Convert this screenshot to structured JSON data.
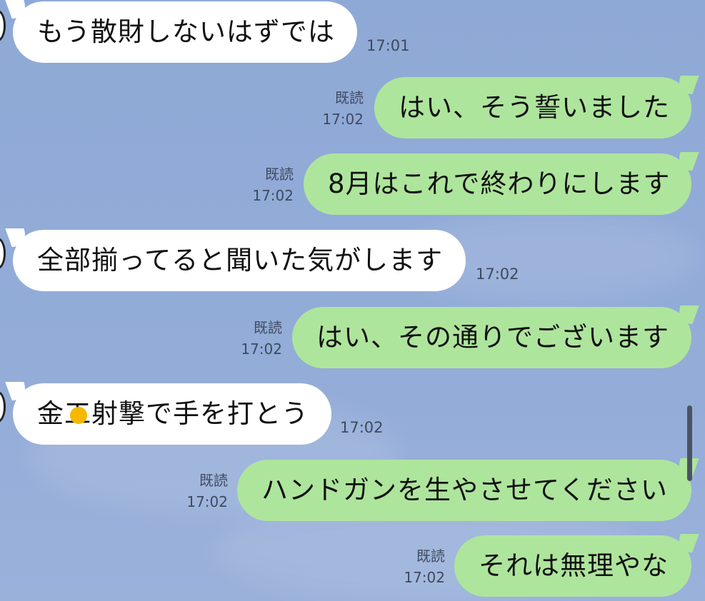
{
  "messages": [
    {
      "side": "in",
      "text": "もう散財しないはずでは",
      "time": "17:01"
    },
    {
      "side": "out",
      "text": "はい、そう誓いました",
      "read": "既読",
      "time": "17:02"
    },
    {
      "side": "out",
      "text": "8月はこれで終わりにします",
      "read": "既読",
      "time": "17:02"
    },
    {
      "side": "in",
      "text": "全部揃ってると聞いた気がします",
      "time": "17:02"
    },
    {
      "side": "out",
      "text": "はい、その通りでございます",
      "read": "既読",
      "time": "17:02"
    },
    {
      "side": "in",
      "text": "金工射撃で手を打とう",
      "time": "17:02"
    },
    {
      "side": "out",
      "text": "ハンドガンを生やさせてください",
      "read": "既読",
      "time": "17:02"
    },
    {
      "side": "out",
      "text": "それは無理やな",
      "read": "既読",
      "time": "17:02"
    }
  ],
  "colors": {
    "background": "#92abd7",
    "incoming_bubble": "#ffffff",
    "outgoing_bubble": "#aee59c",
    "touch_indicator": "#f6b800"
  }
}
